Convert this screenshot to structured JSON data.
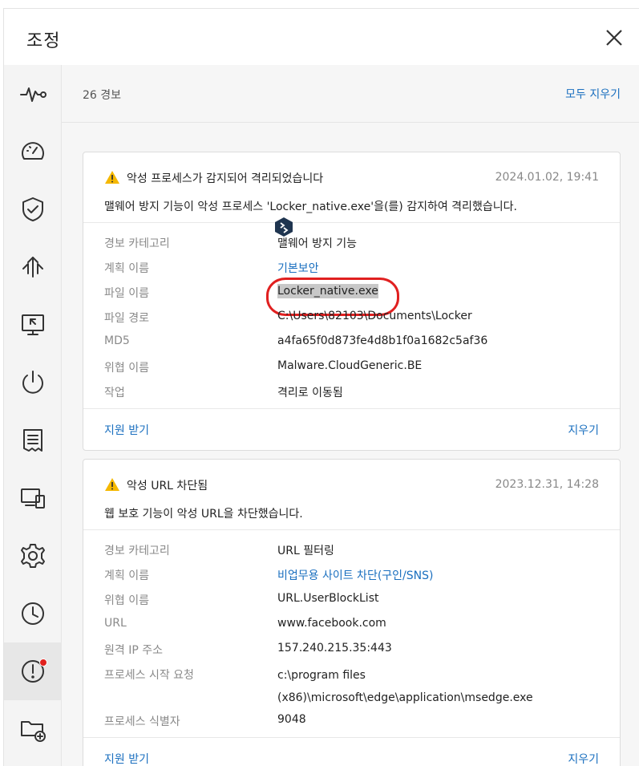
{
  "window": {
    "title": "조정"
  },
  "alerts_header": {
    "count_label": "26 경보",
    "clear_all_label": "모두 지우기"
  },
  "alerts": [
    {
      "title": "악성 프로세스가 감지되어 격리되었습니다",
      "date": "2024.01.02, 19:41",
      "description": "맬웨어 방지 기능이 악성 프로세스 'Locker_native.exe'을(를) 감지하여 격리했습니다.",
      "rows": [
        {
          "label": "경보 카테고리",
          "value": "맬웨어 방지 기능"
        },
        {
          "label": "계획 이름",
          "value": "기본보안"
        },
        {
          "label": "파일 이름",
          "value": "Locker_native.exe"
        },
        {
          "label": "파일 경로",
          "value": "C:\\Users\\82103\\Documents\\Locker"
        },
        {
          "label": "MD5",
          "value": "a4fa65f0d873fe4d8b1f0a1682c5af36"
        },
        {
          "label": "위협 이름",
          "value": "Malware.CloudGeneric.BE"
        },
        {
          "label": "작업",
          "value": "격리로 이동됨"
        }
      ],
      "support_label": "지원 받기",
      "clear_label": "지우기"
    },
    {
      "title": "악성 URL 차단됨",
      "date": "2023.12.31, 14:28",
      "description": "웹 보호 기능이 악성 URL을 차단했습니다.",
      "rows": [
        {
          "label": "경보 카테고리",
          "value": "URL 필터링"
        },
        {
          "label": "계획 이름",
          "value": "비업무용 사이트 차단(구인/SNS)"
        },
        {
          "label": "위협 이름",
          "value": "URL.UserBlockList"
        },
        {
          "label": "URL",
          "value": "www.facebook.com"
        },
        {
          "label": "원격 IP 주소",
          "value": "157.240.215.35:443"
        },
        {
          "label": "프로세스 시작 요청",
          "value_line1": "c:\\program files",
          "value_line2": "(x86)\\microsoft\\edge\\application\\msedge.exe"
        },
        {
          "label": "프로세스 식별자",
          "value": "9048"
        }
      ],
      "support_label": "지원 받기",
      "clear_label": "지우기"
    }
  ],
  "sidebar": {
    "icons": [
      "activity-icon",
      "dashboard-gauge-icon",
      "shield-check-icon",
      "transfer-arrows-icon",
      "remote-desktop-icon",
      "power-icon",
      "report-icon",
      "devices-icon",
      "settings-gear-icon",
      "history-clock-icon",
      "alerts-icon",
      "add-folder-icon"
    ],
    "active": "alerts-icon"
  },
  "colors": {
    "accent": "#1a6fbf",
    "warning": "#f5b800",
    "highlight_circle": "#e02020",
    "notification_dot": "#e0201c"
  }
}
